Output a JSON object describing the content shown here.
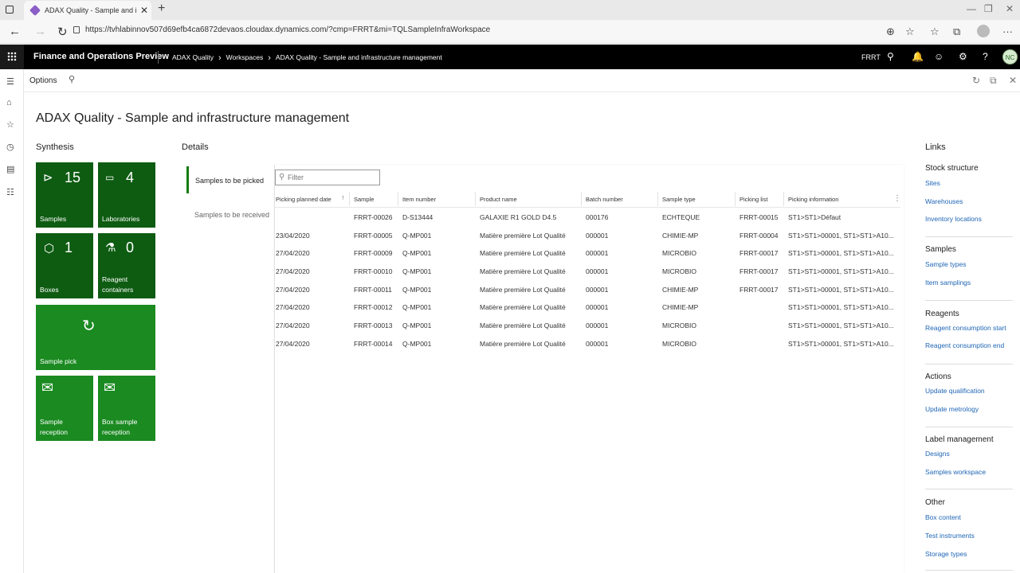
{
  "browser": {
    "tab_title": "ADAX Quality - Sample and infra",
    "url": "https://tvhlabinnov507d69efb4ca6872devaos.cloudax.dynamics.com/?cmp=FRRT&mi=TQLSampleInfraWorkspace"
  },
  "header": {
    "app_name": "Finance and Operations Preview",
    "breadcrumbs": [
      "ADAX Quality",
      "Workspaces",
      "ADAX Quality - Sample and infrastructure management"
    ],
    "company": "FRRT",
    "avatar_initials": "NC"
  },
  "actionpane": {
    "options_label": "Options"
  },
  "page": {
    "title": "ADAX Quality - Sample and infrastructure management",
    "synthesis_label": "Synthesis",
    "details_label": "Details",
    "links_label": "Links"
  },
  "tiles": [
    {
      "count": "15",
      "label": "Samples",
      "icon": "tag-icon"
    },
    {
      "count": "4",
      "label": "Laboratories",
      "icon": "laboratory-icon"
    },
    {
      "count": "1",
      "label": "Boxes",
      "icon": "box-icon"
    },
    {
      "count": "0",
      "label": "Reagent containers",
      "icon": "reagent-icon"
    },
    {
      "count": "",
      "label": "Sample pick",
      "icon": "refresh-arrow-icon"
    },
    {
      "count": "",
      "label": "Sample reception",
      "icon": "mail-icon"
    },
    {
      "count": "",
      "label": "Box sample reception",
      "icon": "mail-icon"
    }
  ],
  "details": {
    "tabs": [
      "Samples to be picked",
      "Samples to be received"
    ],
    "filter_placeholder": "Filter",
    "columns": [
      "Picking planned date",
      "Sample",
      "Item number",
      "Product name",
      "Batch number",
      "Sample type",
      "Picking list",
      "Picking information"
    ],
    "rows": [
      [
        "",
        "FRRT-00026",
        "D-S13444",
        "GALAXIE R1 GOLD D4.5",
        "000176",
        "ECHTEQUE",
        "FRRT-00015",
        "ST1>ST1>Défaut"
      ],
      [
        "23/04/2020",
        "FRRT-00005",
        "Q-MP001",
        "Matière première Lot Qualité",
        "000001",
        "CHIMIE-MP",
        "FRRT-00004",
        "ST1>ST1>00001, ST1>ST1>A10..."
      ],
      [
        "27/04/2020",
        "FRRT-00009",
        "Q-MP001",
        "Matière première Lot Qualité",
        "000001",
        "MICROBIO",
        "FRRT-00017",
        "ST1>ST1>00001, ST1>ST1>A10..."
      ],
      [
        "27/04/2020",
        "FRRT-00010",
        "Q-MP001",
        "Matière première Lot Qualité",
        "000001",
        "MICROBIO",
        "FRRT-00017",
        "ST1>ST1>00001, ST1>ST1>A10..."
      ],
      [
        "27/04/2020",
        "FRRT-00011",
        "Q-MP001",
        "Matière première Lot Qualité",
        "000001",
        "CHIMIE-MP",
        "FRRT-00017",
        "ST1>ST1>00001, ST1>ST1>A10..."
      ],
      [
        "27/04/2020",
        "FRRT-00012",
        "Q-MP001",
        "Matière première Lot Qualité",
        "000001",
        "CHIMIE-MP",
        "",
        "ST1>ST1>00001, ST1>ST1>A10..."
      ],
      [
        "27/04/2020",
        "FRRT-00013",
        "Q-MP001",
        "Matière première Lot Qualité",
        "000001",
        "MICROBIO",
        "",
        "ST1>ST1>00001, ST1>ST1>A10..."
      ],
      [
        "27/04/2020",
        "FRRT-00014",
        "Q-MP001",
        "Matière première Lot Qualité",
        "000001",
        "MICROBIO",
        "",
        "ST1>ST1>00001, ST1>ST1>A10..."
      ]
    ]
  },
  "links": [
    {
      "header": "Stock structure",
      "items": [
        "Sites",
        "Warehouses",
        "Inventory locations"
      ]
    },
    {
      "header": "Samples",
      "items": [
        "Sample types",
        "Item samplings"
      ]
    },
    {
      "header": "Reagents",
      "items": [
        "Reagent consumption start",
        "Reagent consumption end"
      ]
    },
    {
      "header": "Actions",
      "items": [
        "Update qualification",
        "Update metrology"
      ]
    },
    {
      "header": "Label management",
      "items": [
        "Designs",
        "Samples workspace"
      ]
    },
    {
      "header": "Other",
      "items": [
        "Box content",
        "Test instruments",
        "Storage types"
      ]
    }
  ],
  "colors": {
    "tile_dark": "#0e5c12",
    "tile_light": "#1a8a21",
    "link": "#1f65b5",
    "accent": "#107c10"
  }
}
